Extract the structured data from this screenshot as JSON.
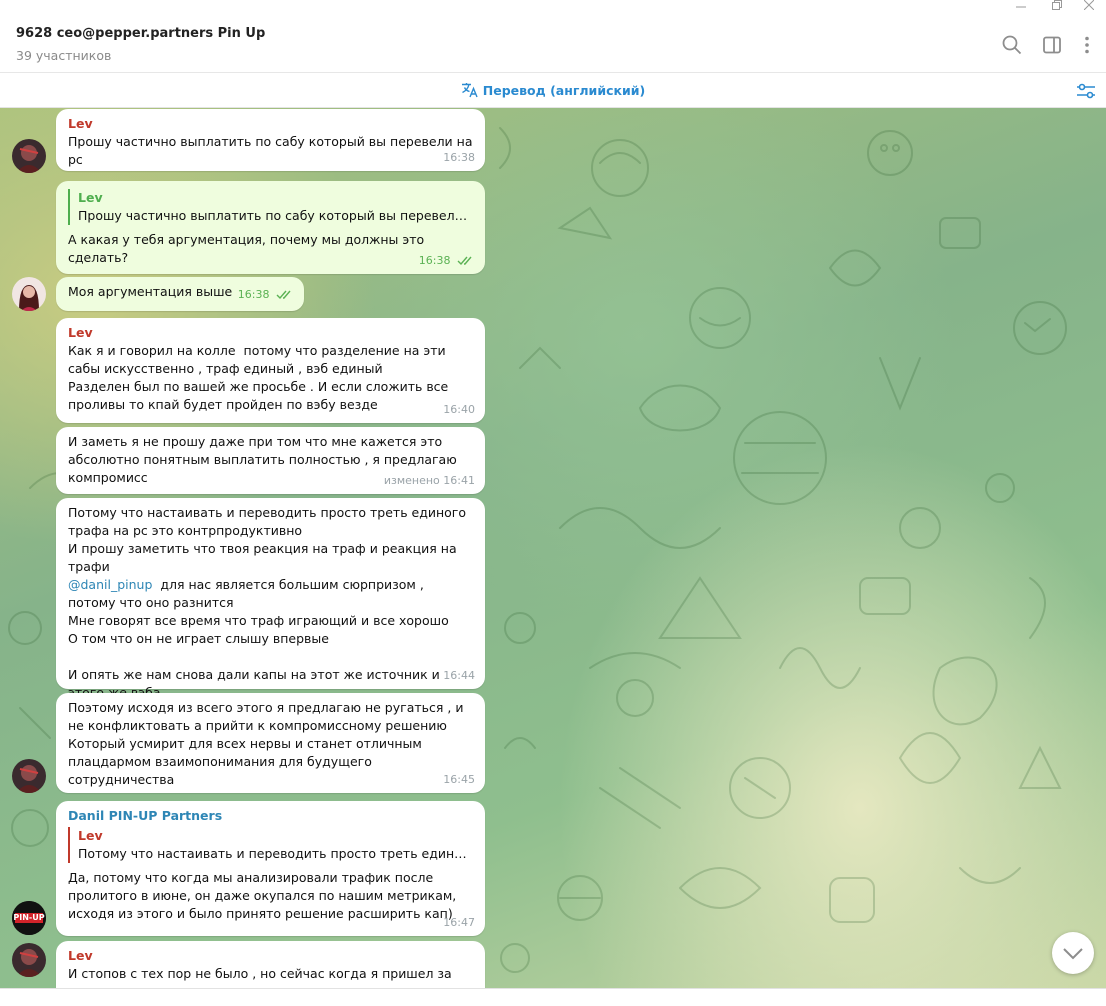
{
  "window": {
    "minimize_icon": "minimize-icon",
    "restore_icon": "restore-icon",
    "close_icon": "close-icon"
  },
  "header": {
    "title": "9628 ceo@pepper.partners Pin Up",
    "subtitle": "39 участников",
    "icons": [
      "search-icon",
      "sidebar-toggle-icon",
      "more-vert-icon"
    ]
  },
  "translate": {
    "label": "Перевод (английский)",
    "icon": "translate-icon",
    "settings_icon": "sliders-icon"
  },
  "colors": {
    "accent": "#2a8ad0",
    "lev": "#c0392b",
    "danil": "#2e86b5",
    "outgoing": "#effdde",
    "out_time": "#5bb254"
  },
  "messages": [
    {
      "sender": "Lev",
      "text": "Прошу частично выплатить по сабу который вы перевели на рс",
      "time": "16:38"
    },
    {
      "reply_name": "Lev",
      "reply_text": "Прошу частично выплатить по сабу который вы перевели на рс",
      "text": "А какая у тебя аргументация, почему мы должны это сделать?",
      "time": "16:38"
    },
    {
      "text": "Моя аргументация выше",
      "time": "16:38"
    },
    {
      "sender": "Lev",
      "text": "Как я и говорил на колле  потому что разделение на эти сабы искусственно , траф единый , вэб единый\nРазделен был по вашей же просьбе . И если сложить все проливы то кпай будет пройден по вэбу везде",
      "time": "16:40"
    },
    {
      "text": "И заметь я не прошу даже при том что мне кажется это абсолютно понятным выплатить полностью , я предлагаю компромисс",
      "time": "изменено 16:41"
    },
    {
      "text_before": "Потому что настаивать и переводить просто треть единого трафа на рс это контрпродуктивно\nИ прошу заметить что твоя реакция на траф и реакция на трафи\n",
      "mention": "@danil_pinup",
      "text_after": "  для нас является большим сюрпризом , потому что оно разнится\nМне говорят все время что траф играющий и все хорошо\nО том что он не играет слышу впервые\n\nИ опять же нам снова дали капы на этот же источник и этого же вэба",
      "time": "16:44"
    },
    {
      "text": "Поэтому исходя из всего этого я предлагаю не ругаться , и не конфликтовать а прийти к компромиссному решению\nКоторый усмирит для всех нервы и станет отличным плацдармом взаимопонимания для будущего сотрудничества",
      "time": "16:45"
    },
    {
      "sender": "Danil PIN-UP Partners",
      "reply_name": "Lev",
      "reply_text": "Потому что настаивать и переводить просто треть единого трафа на рс это контрпродуктивно",
      "text": "Да, потому что когда мы анализировали трафик после пролитого в июне, он даже окупался по нашим метрикам, исходя из этого и было принято решение расширить кап)",
      "time": "16:47"
    },
    {
      "sender": "Lev",
      "text": "И стопов с тех пор не было , но сейчас когда я пришел за тем"
    }
  ],
  "avatars": {
    "danil_logo": "PIN-UP"
  },
  "scroll_down_icon": "chevron-down-icon"
}
